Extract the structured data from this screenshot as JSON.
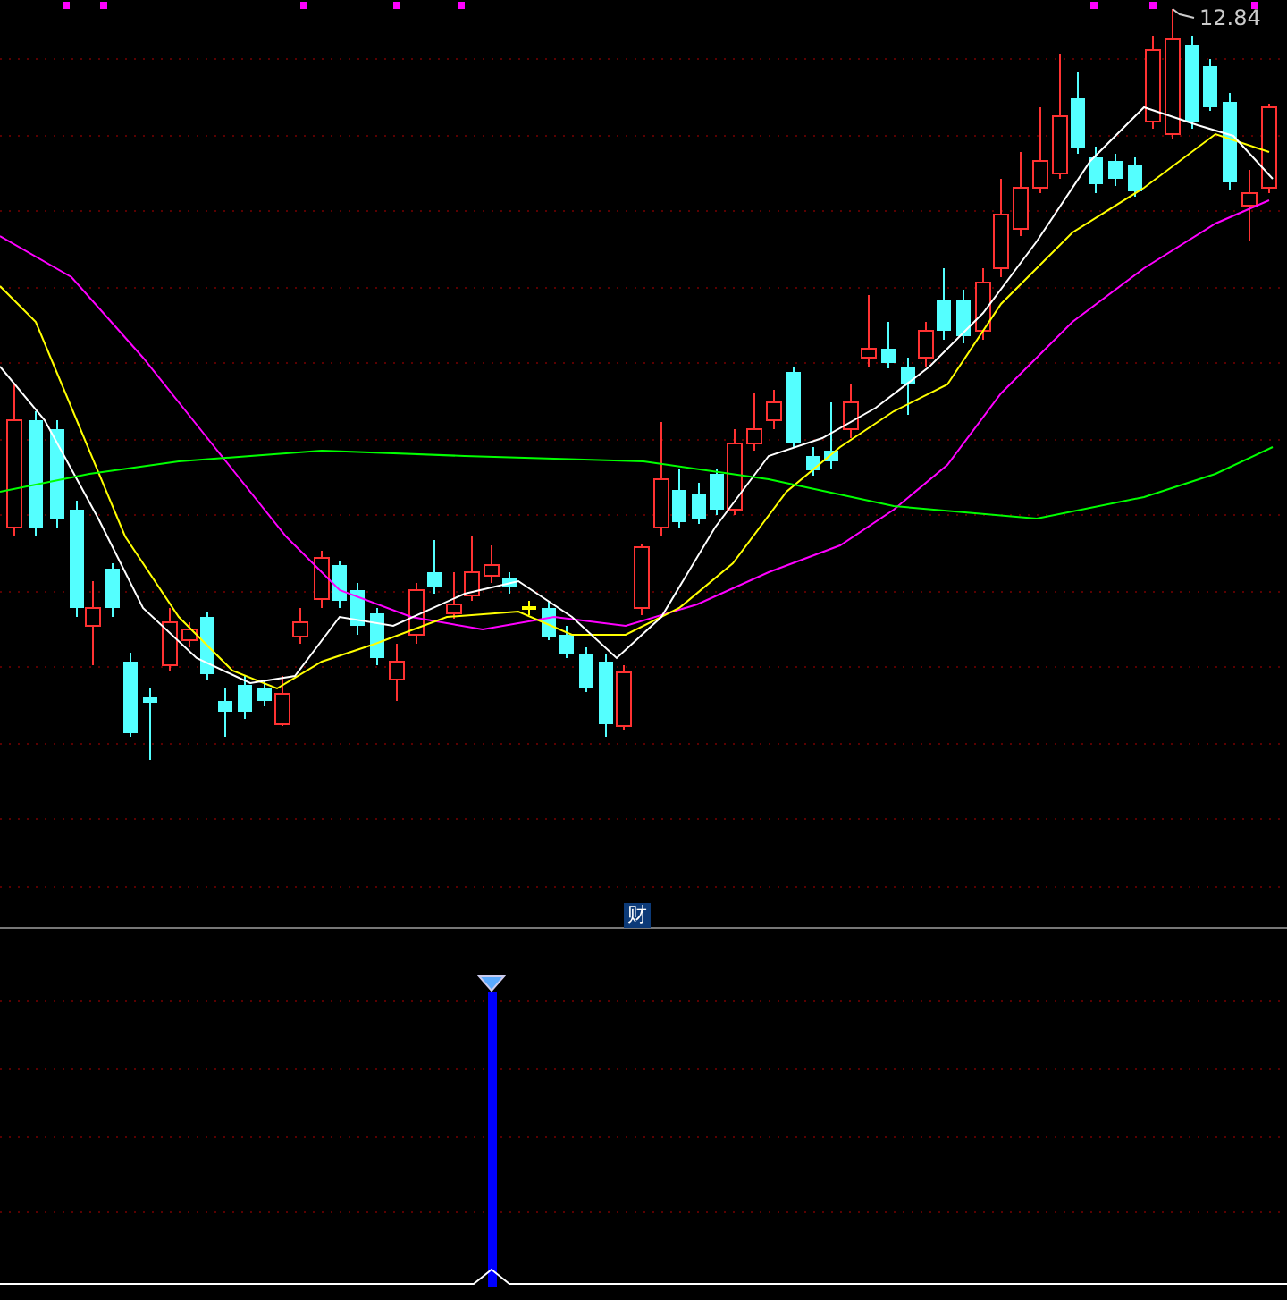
{
  "price_chart": {
    "high_label": "12.84"
  },
  "indicator_panel": {
    "badge": "财"
  }
}
